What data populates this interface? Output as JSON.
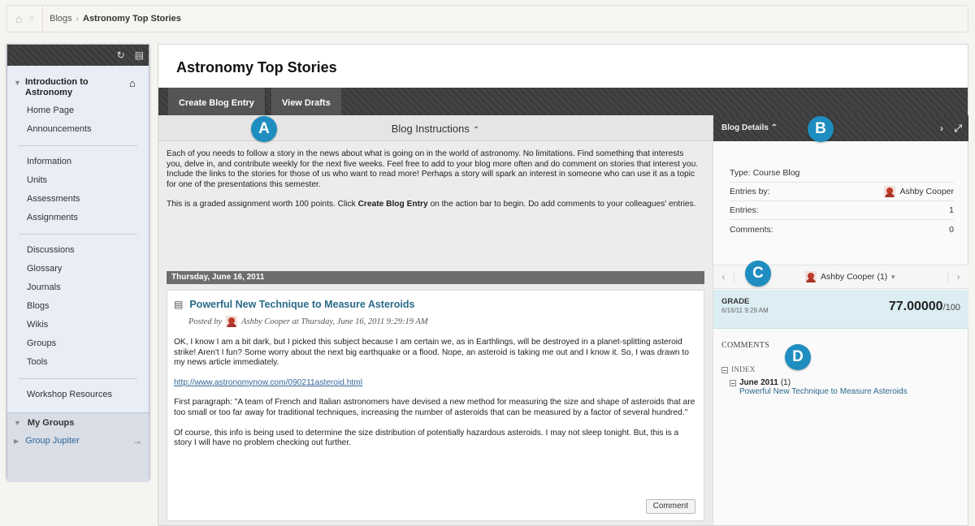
{
  "breadcrumb": {
    "home_icon": "home-icon",
    "refresh_icon": "refresh-icon",
    "items": [
      "Blogs",
      "Astronomy Top Stories"
    ]
  },
  "sidebar": {
    "top_icons": [
      "refresh-icon",
      "folder-icon"
    ],
    "course_title": "Introduction to Astronomy",
    "groups": [
      [
        "Home Page",
        "Announcements"
      ],
      [
        "Information",
        "Units",
        "Assessments",
        "Assignments"
      ],
      [
        "Discussions",
        "Glossary",
        "Journals",
        "Blogs",
        "Wikis",
        "Groups",
        "Tools"
      ],
      [
        "Workshop Resources"
      ]
    ],
    "my_groups_label": "My Groups",
    "group_item": "Group Jupiter"
  },
  "page": {
    "title": "Astronomy Top Stories",
    "actions": {
      "create": "Create Blog Entry",
      "drafts": "View Drafts"
    }
  },
  "instructions": {
    "header": "Blog Instructions",
    "para1": "Each of you needs to follow a story in the news about what is going on in the world of astronomy. No limitations. Find something that interests you, delve in, and contribute weekly for the next five weeks. Feel free to add to your blog more often and do comment on stories that interest you. Include the links to the stories for those of us who want to read more! Perhaps a story will spark an interest in someone who can use it as a topic for one of the presentations this semester.",
    "para2_pre": "This is a graded assignment worth 100 points. Click ",
    "para2_bold": "Create Blog Entry",
    "para2_post": " on the action bar to begin. Do add comments to your colleagues' entries."
  },
  "entry": {
    "date": "Thursday, June 16, 2011",
    "title": "Powerful New Technique to Measure Asteroids",
    "posted_by": "Posted by",
    "author": "Ashby Cooper",
    "posted_at": "at Thursday, June 16, 2011 9:29:19 AM",
    "p1": "OK, I know I am a bit dark, but I picked this subject because I am certain we, as in Earthlings, will be destroyed in a planet-splitting asteroid strike! Aren't I fun? Some worry about the next big earthquake or a flood. Nope, an asteroid is taking me out and I know it. So, I was drawn to my news article immediately.",
    "link": "http://www.astronomynow.com/090211asteroid.html",
    "p2": "First paragraph: \"A team of French and Italian astronomers have devised a new method for measuring the size and shape of asteroids that are too small or too far away for traditional techniques, increasing the number of asteroids that can be measured by a factor of several hundred.\"",
    "p3": "Of course, this info is being used to determine the size distribution of potentially hazardous asteroids. I may not sleep tonight. But, this is a story I will have no problem checking out further.",
    "comment_button": "Comment"
  },
  "details": {
    "header": "Blog Details",
    "type": "Type: Course Blog",
    "entries_by_label": "Entries by:",
    "entries_by_value": "Ashby Cooper",
    "entries_label": "Entries:",
    "entries_value": "1",
    "comments_label": "Comments:",
    "comments_value": "0"
  },
  "user_nav": {
    "name": "Ashby Cooper (1)"
  },
  "grade": {
    "label": "GRADE",
    "date": "6/16/11 9:29 AM",
    "value": "77.00000",
    "max": "/100"
  },
  "comments": {
    "header": "COMMENTS",
    "index_label": "INDEX",
    "month": "June 2011",
    "month_count": "(1)",
    "entry_link": "Powerful New Technique to Measure Asteroids"
  },
  "markers": {
    "a": "A",
    "b": "B",
    "c": "C",
    "d": "D"
  },
  "colors": {
    "marker": "#1e8dbf",
    "action_bar": "#3d3d3d",
    "grade_bg": "#dcedf4",
    "link": "#2a6a8a"
  }
}
